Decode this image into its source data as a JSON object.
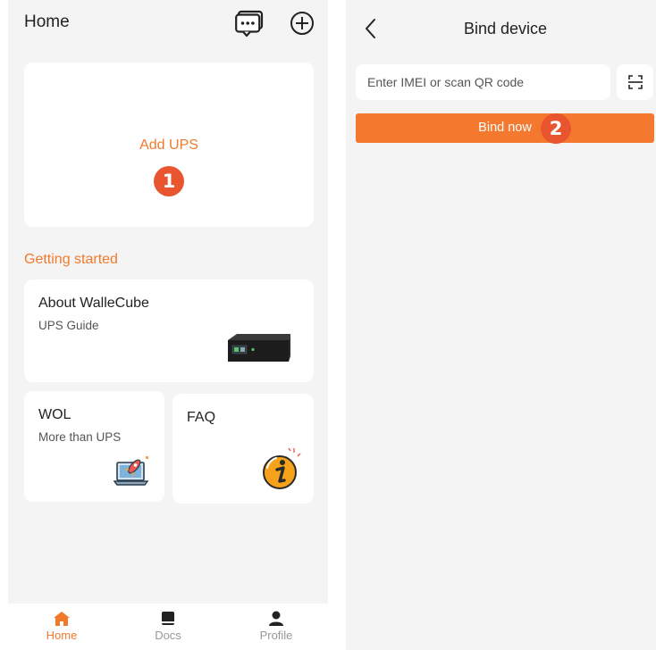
{
  "left": {
    "header": {
      "title": "Home"
    },
    "add_card": {
      "label": "Add UPS",
      "step": "1"
    },
    "getting_started": {
      "title": "Getting started",
      "about": {
        "title": "About WalleCube",
        "subtitle": "UPS Guide"
      },
      "wol": {
        "title": "WOL",
        "subtitle": "More than UPS"
      },
      "faq": {
        "title": "FAQ"
      }
    },
    "bottom_nav": [
      {
        "label": "Home",
        "icon": "home-icon",
        "active": true
      },
      {
        "label": "Docs",
        "icon": "book-icon",
        "active": false
      },
      {
        "label": "Profile",
        "icon": "user-icon",
        "active": false
      }
    ]
  },
  "right": {
    "header": {
      "title": "Bind device"
    },
    "imei": {
      "placeholder": "Enter IMEI or scan QR code",
      "value": ""
    },
    "bind_button": {
      "label": "Bind now",
      "step": "2"
    }
  },
  "colors": {
    "accent": "#f07a2c",
    "badge": "#e9552f",
    "bind_button": "#f4792f",
    "background": "#f4f4f4"
  }
}
